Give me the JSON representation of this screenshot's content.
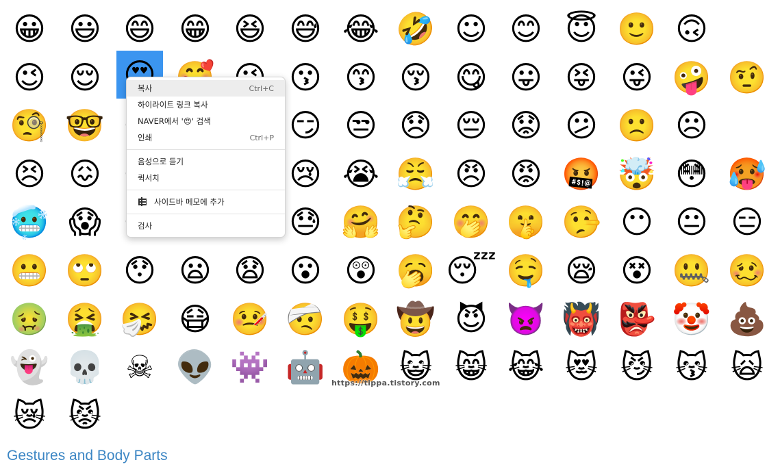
{
  "emoji_grid": [
    [
      "😀",
      "😃",
      "😄",
      "😁",
      "😆",
      "😅",
      "😂",
      "🤣",
      "☺",
      "😊",
      "😇",
      "🙂",
      "🙃"
    ],
    [
      "😉",
      "😌",
      "😍",
      "🥰",
      "😘",
      "😗",
      "😙",
      "😚",
      "😋",
      "😛",
      "😝",
      "😜",
      "🤪",
      "🤨"
    ],
    [
      "🧐",
      "🤓",
      "😎",
      "🤩",
      "🥳",
      "😏",
      "😒",
      "😞",
      "😔",
      "😟",
      "😕",
      "🙁",
      "☹"
    ],
    [
      "😣",
      "😖",
      "😫",
      "😩",
      "🥺",
      "😢",
      "😭",
      "😤",
      "😠",
      "😡",
      "🤬",
      "🤯",
      "😳",
      "🥵"
    ],
    [
      "🥶",
      "😱",
      "😨",
      "😰",
      "😥",
      "😓",
      "🤗",
      "🤔",
      "🤭",
      "🤫",
      "🤥",
      "😶",
      "😐",
      "😑"
    ],
    [
      "😬",
      "🙄",
      "😯",
      "😦",
      "😧",
      "😮",
      "😲",
      "🥱",
      "😴",
      "🤤",
      "😪",
      "😵",
      "🤐",
      "🥴"
    ],
    [
      "🤢",
      "🤮",
      "🤧",
      "😷",
      "🤒",
      "🤕",
      "🤑",
      "🤠",
      "😈",
      "👿",
      "👹",
      "👺",
      "🤡",
      "💩"
    ],
    [
      "👻",
      "💀",
      "☠",
      "👽",
      "👾",
      "🤖",
      "🎃",
      "😺",
      "😸",
      "😹",
      "😻",
      "😼",
      "😽",
      "🙀"
    ],
    [
      "😿",
      "😾"
    ]
  ],
  "selected_emoji": "😍",
  "watermark": "https://tippa.tistory.com",
  "section_heading": "Gestures and Body Parts",
  "context_menu": {
    "copy": {
      "label": "복사",
      "shortcut": "Ctrl+C"
    },
    "copy_highlight_link": {
      "label": "하이라이트 링크 복사"
    },
    "search_naver": {
      "label": "NAVER에서 '😍' 검색"
    },
    "print": {
      "label": "인쇄",
      "shortcut": "Ctrl+P"
    },
    "read_aloud": {
      "label": "음성으로 듣기"
    },
    "quick_search": {
      "label": "퀵서치"
    },
    "add_sidebar_memo": {
      "label": "사이드바 메모에 추가",
      "icon": "memo-grid-icon"
    },
    "inspect": {
      "label": "검사"
    }
  },
  "colors": {
    "selection": "#3b95f0",
    "heading": "#3c86c4",
    "menu_hover": "#ededed"
  }
}
